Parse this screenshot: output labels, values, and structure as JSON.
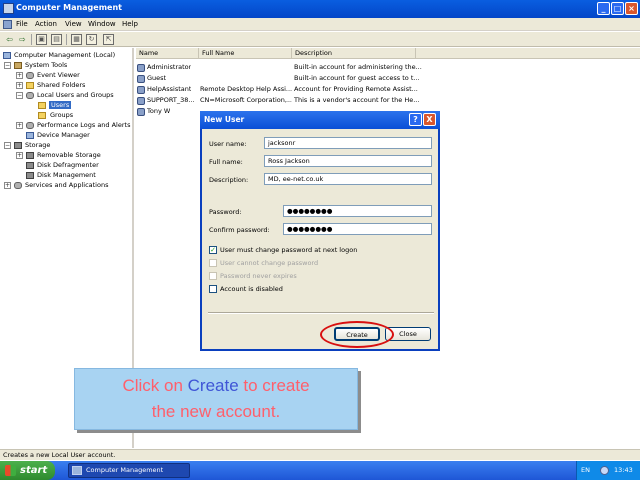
{
  "window": {
    "title": "Computer Management"
  },
  "menu": [
    "File",
    "Action",
    "View",
    "Window",
    "Help"
  ],
  "toolbar": {
    "buttons": [
      "back-icon",
      "forward-icon",
      "up-folder-icon",
      "show-tree-icon",
      "properties-icon",
      "refresh-icon",
      "export-icon"
    ]
  },
  "tree": {
    "root": "Computer Management (Local)",
    "system_tools": "System Tools",
    "event_viewer": "Event Viewer",
    "shared_folders": "Shared Folders",
    "local_users_groups": "Local Users and Groups",
    "users": "Users",
    "groups": "Groups",
    "perf_logs": "Performance Logs and Alerts",
    "device_manager": "Device Manager",
    "storage": "Storage",
    "removable_storage": "Removable Storage",
    "disk_defrag": "Disk Defragmenter",
    "disk_mgmt": "Disk Management",
    "services": "Services and Applications"
  },
  "list": {
    "columns": [
      "Name",
      "Full Name",
      "Description"
    ],
    "rows": [
      {
        "name": "Administrator",
        "full_name": "",
        "description": "Built-in account for administering the..."
      },
      {
        "name": "Guest",
        "full_name": "",
        "description": "Built-in account for guest access to t..."
      },
      {
        "name": "HelpAssistant",
        "full_name": "Remote Desktop Help Assi...",
        "description": "Account for Providing Remote Assist..."
      },
      {
        "name": "SUPPORT_38...",
        "full_name": "CN=Microsoft Corporation,...",
        "description": "This is a vendor's account for the He..."
      },
      {
        "name": "Tony W",
        "full_name": "",
        "description": ""
      }
    ]
  },
  "status": "Creates a new Local User account.",
  "dialog": {
    "title": "New User",
    "help_label": "?",
    "close_label": "X",
    "username_label": "User name:",
    "username_value": "jacksonr",
    "fullname_label": "Full name:",
    "fullname_value": "Ross Jackson",
    "description_label": "Description:",
    "description_value": "MD, ee-net.co.uk",
    "password_label": "Password:",
    "password_value": "●●●●●●●●",
    "confirm_label": "Confirm password:",
    "confirm_value": "●●●●●●●●",
    "chk_must_change": "User must change password at next logon",
    "chk_cannot_change": "User cannot change password",
    "chk_never_expires": "Password never expires",
    "chk_disabled": "Account is disabled",
    "create_label": "Create",
    "close_button_label": "Close"
  },
  "callout": {
    "line1_pre": "Click on ",
    "line1_hl": "Create",
    "line1_post": " to create",
    "line2": "the new account."
  },
  "taskbar": {
    "start_label": "start",
    "task_label": "Computer Management",
    "lang": "EN",
    "clock": "13:43"
  }
}
